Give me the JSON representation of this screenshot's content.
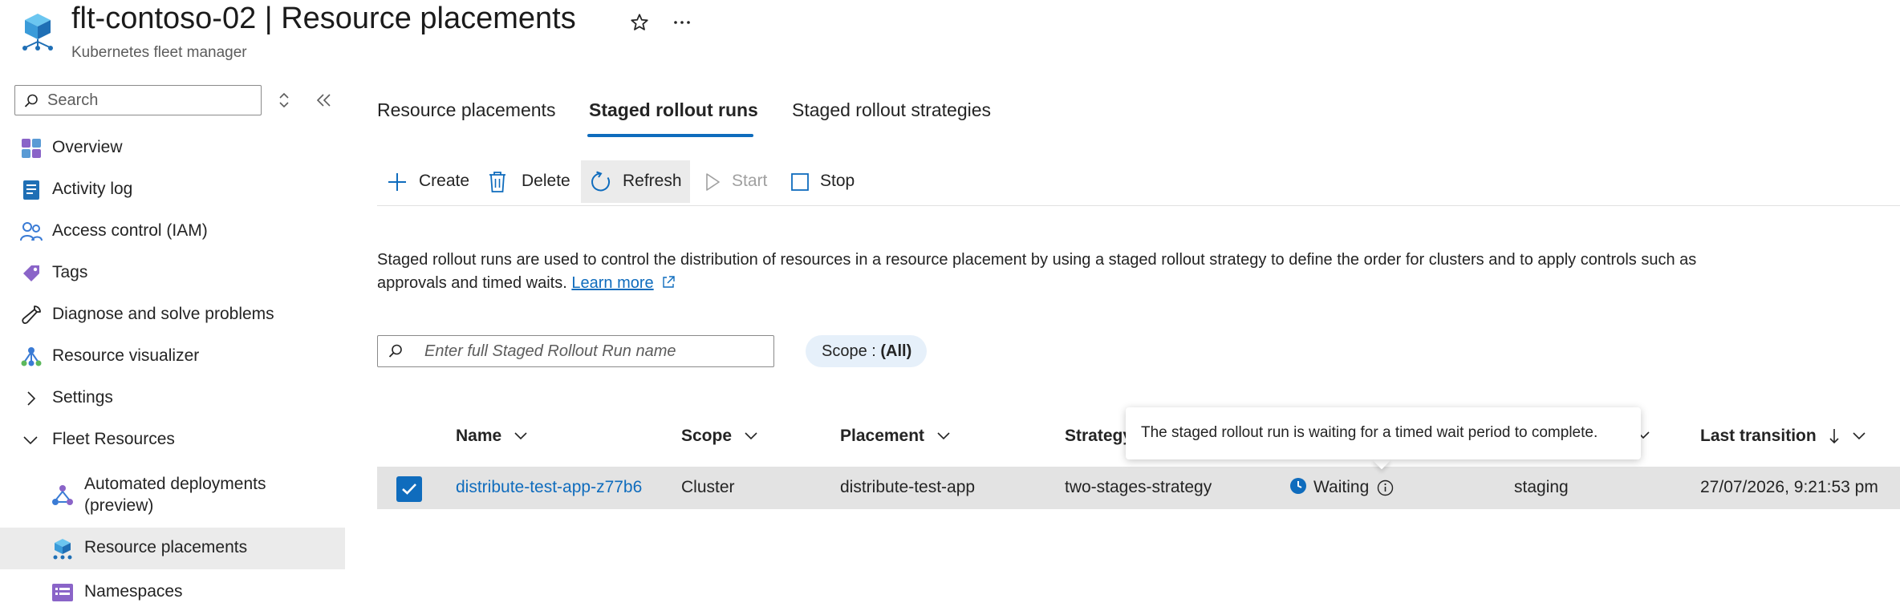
{
  "header": {
    "title": "flt-contoso-02 | Resource placements",
    "subtitle": "Kubernetes fleet manager",
    "favorite_icon": "star-icon",
    "more_icon": "ellipsis-icon"
  },
  "sidebar": {
    "search_placeholder": "Search",
    "items": [
      {
        "label": "Overview",
        "icon": "overview-icon"
      },
      {
        "label": "Activity log",
        "icon": "activity-log-icon"
      },
      {
        "label": "Access control (IAM)",
        "icon": "people-icon"
      },
      {
        "label": "Tags",
        "icon": "tag-icon"
      },
      {
        "label": "Diagnose and solve problems",
        "icon": "wrench-icon"
      },
      {
        "label": "Resource visualizer",
        "icon": "hierarchy-icon"
      },
      {
        "label": "Settings",
        "icon": "chevron-right-icon"
      },
      {
        "label": "Fleet Resources",
        "icon": "chevron-down-icon"
      },
      {
        "label": "Automated deployments",
        "label2": "(preview)",
        "icon": "deployment-icon"
      },
      {
        "label": "Resource placements",
        "icon": "placement-icon",
        "selected": true
      },
      {
        "label": "Namespaces",
        "icon": "namespace-icon"
      }
    ]
  },
  "tabs": [
    {
      "label": "Resource placements",
      "active": false
    },
    {
      "label": "Staged rollout runs",
      "active": true
    },
    {
      "label": "Staged rollout strategies",
      "active": false
    }
  ],
  "toolbar": {
    "create": "Create",
    "delete": "Delete",
    "refresh": "Refresh",
    "start": "Start",
    "stop": "Stop"
  },
  "description": {
    "text": "Staged rollout runs are used to control the distribution of resources in a resource placement by using a staged rollout strategy to define the order for clusters and to apply controls such as approvals and timed waits.",
    "link": "Learn more"
  },
  "filter": {
    "placeholder": "Enter full Staged Rollout Run name",
    "scope_label": "Scope : ",
    "scope_value": "(All)"
  },
  "table": {
    "columns": [
      "Name",
      "Scope",
      "Placement",
      "Strategy",
      "Last transition"
    ],
    "rows": [
      {
        "name": "distribute-test-app-z77b6",
        "scope": "Cluster",
        "placement": "distribute-test-app",
        "strategy": "two-stages-strategy",
        "status": "Waiting",
        "stage": "staging",
        "last_transition": "27/07/2026, 9:21:53 pm"
      }
    ]
  },
  "tooltip": {
    "text": "The staged rollout run is waiting for a timed wait period to complete."
  },
  "colors": {
    "accent": "#0f6cbd",
    "selected_row": "#e3e3e3",
    "selected_nav": "#ebebeb",
    "scope_pill": "#e6f0fa"
  }
}
